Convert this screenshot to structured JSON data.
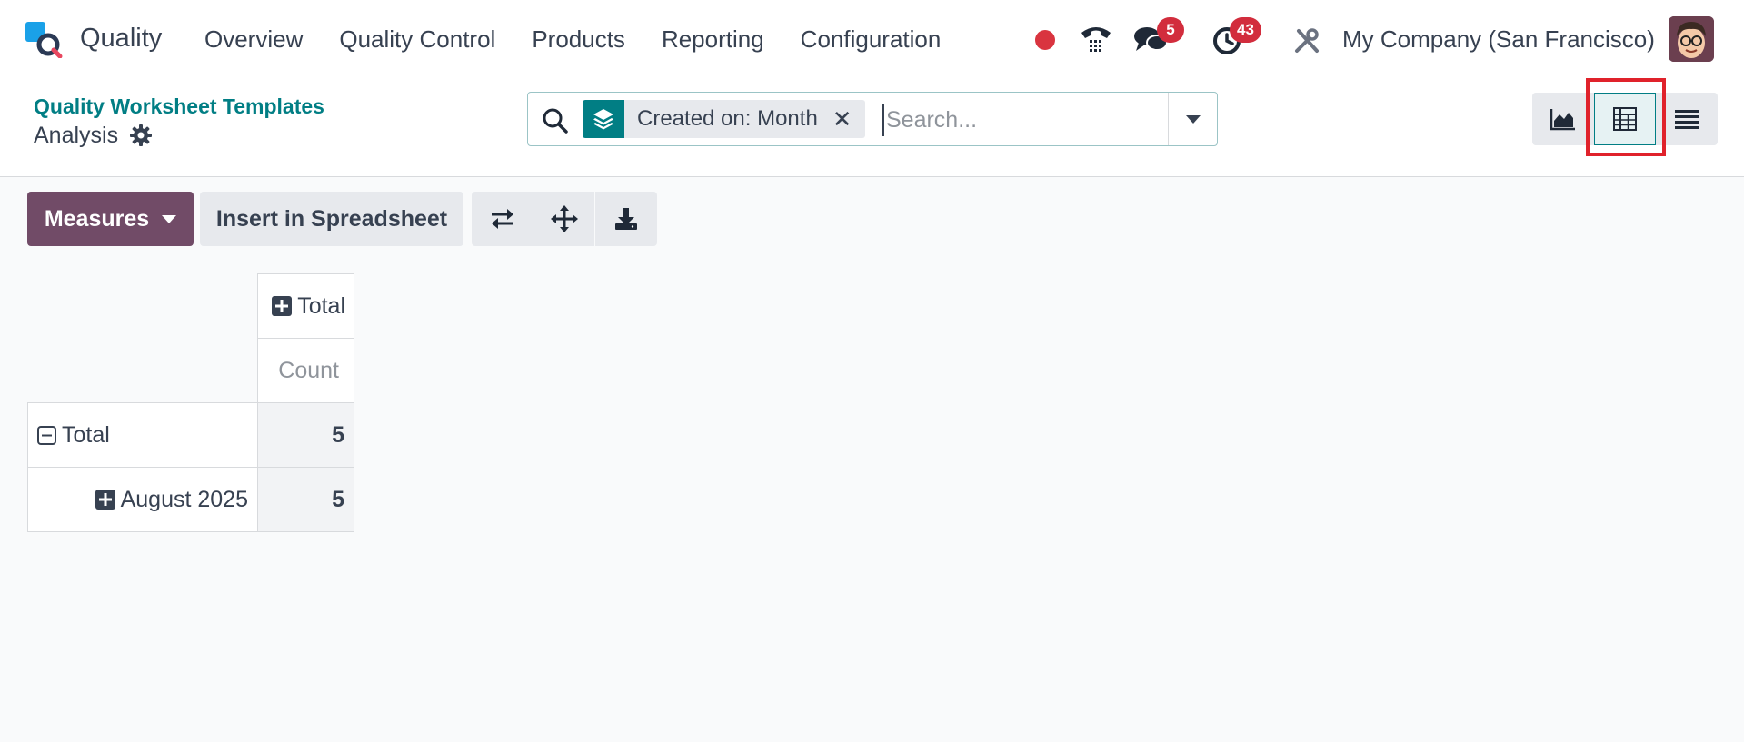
{
  "app": {
    "name": "Quality"
  },
  "menu": [
    "Overview",
    "Quality Control",
    "Products",
    "Reporting",
    "Configuration"
  ],
  "systray": {
    "messages_count": "5",
    "activities_count": "43",
    "company": "My Company (San Francisco)"
  },
  "breadcrumb": {
    "parent": "Quality Worksheet Templates",
    "current": "Analysis"
  },
  "search": {
    "facet_label": "Created on: Month",
    "placeholder": "Search..."
  },
  "toolbar": {
    "measures_label": "Measures",
    "insert_label": "Insert in Spreadsheet"
  },
  "pivot": {
    "col_header": "Total",
    "measure": "Count",
    "rows": [
      {
        "label": "Total",
        "value": "5"
      },
      {
        "label": "August 2025",
        "value": "5"
      }
    ]
  },
  "colors": {
    "brand": "#714b67",
    "accent": "#017e84",
    "badge": "#d22d3d",
    "highlight": "#e0222b"
  }
}
